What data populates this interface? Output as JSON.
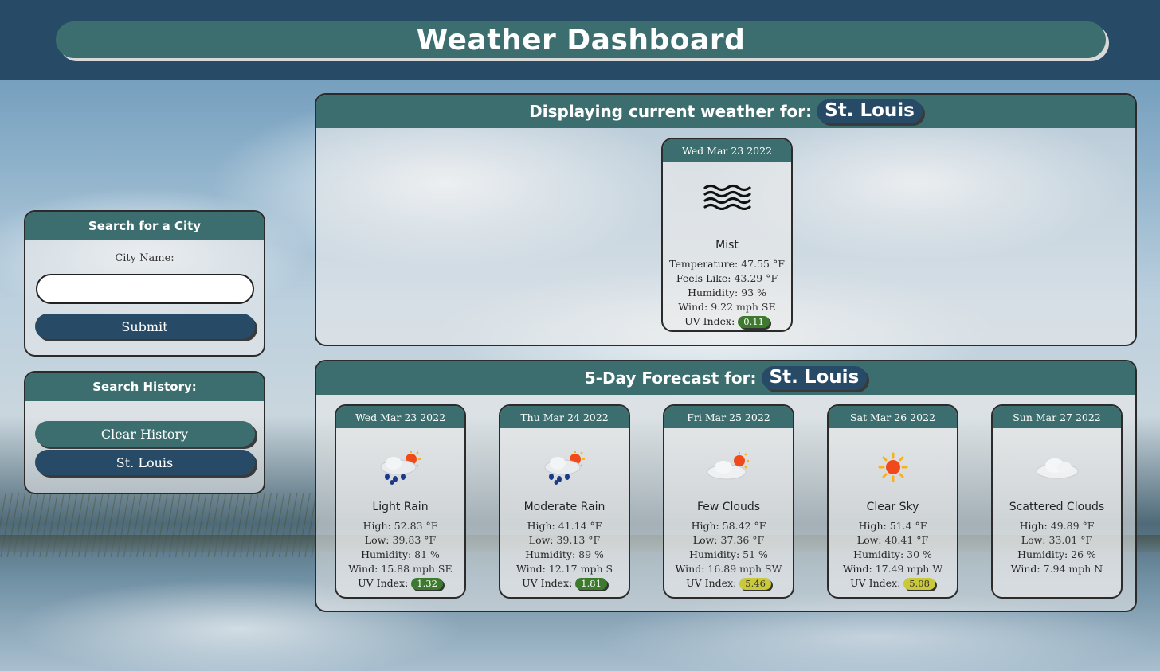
{
  "header": {
    "title": "Weather Dashboard"
  },
  "search": {
    "title": "Search for a City",
    "label": "City Name:",
    "input_value": "",
    "submit_label": "Submit"
  },
  "history": {
    "title": "Search History:",
    "clear_label": "Clear History",
    "items": [
      "St. Louis"
    ]
  },
  "current": {
    "heading": "Displaying current weather for:",
    "city": "St. Louis",
    "card": {
      "date": "Wed Mar 23 2022",
      "icon": "mist-icon",
      "description": "Mist",
      "temperature_label": "Temperature:",
      "temperature": "47.55 °F",
      "feels_like_label": "Feels Like:",
      "feels_like": "43.29 °F",
      "humidity_label": "Humidity:",
      "humidity": "93 %",
      "wind_label": "Wind:",
      "wind": "9.22 mph SE",
      "uv_label": "UV Index:",
      "uv": "0.11",
      "uv_level": "green"
    }
  },
  "forecast": {
    "heading": "5-Day Forecast for:",
    "city": "St. Louis",
    "labels": {
      "high": "High:",
      "low": "Low:",
      "humidity": "Humidity:",
      "wind": "Wind:",
      "uv": "UV Index:"
    },
    "days": [
      {
        "date": "Wed Mar 23 2022",
        "icon": "rain-sun-icon",
        "description": "Light Rain",
        "high": "52.83 °F",
        "low": "39.83 °F",
        "humidity": "81 %",
        "wind": "15.88 mph SE",
        "uv": "1.32",
        "uv_level": "green"
      },
      {
        "date": "Thu Mar 24 2022",
        "icon": "rain-sun-icon",
        "description": "Moderate Rain",
        "high": "41.14 °F",
        "low": "39.13 °F",
        "humidity": "89 %",
        "wind": "12.17 mph S",
        "uv": "1.81",
        "uv_level": "green"
      },
      {
        "date": "Fri Mar 25 2022",
        "icon": "cloud-sun-icon",
        "description": "Few Clouds",
        "high": "58.42 °F",
        "low": "37.36 °F",
        "humidity": "51 %",
        "wind": "16.89 mph SW",
        "uv": "5.46",
        "uv_level": "yellow"
      },
      {
        "date": "Sat Mar 26 2022",
        "icon": "sun-icon",
        "description": "Clear Sky",
        "high": "51.4 °F",
        "low": "40.41 °F",
        "humidity": "30 %",
        "wind": "17.49 mph W",
        "uv": "5.08",
        "uv_level": "yellow"
      },
      {
        "date": "Sun Mar 27 2022",
        "icon": "cloud-icon",
        "description": "Scattered Clouds",
        "high": "49.89 °F",
        "low": "33.01 °F",
        "humidity": "26 %",
        "wind": "7.94 mph N",
        "uv": "",
        "uv_level": ""
      }
    ]
  },
  "colors": {
    "header": "#274a66",
    "teal": "#3c6e6f",
    "uv_green": "#3e7a2e",
    "uv_yellow": "#c9c93a"
  }
}
